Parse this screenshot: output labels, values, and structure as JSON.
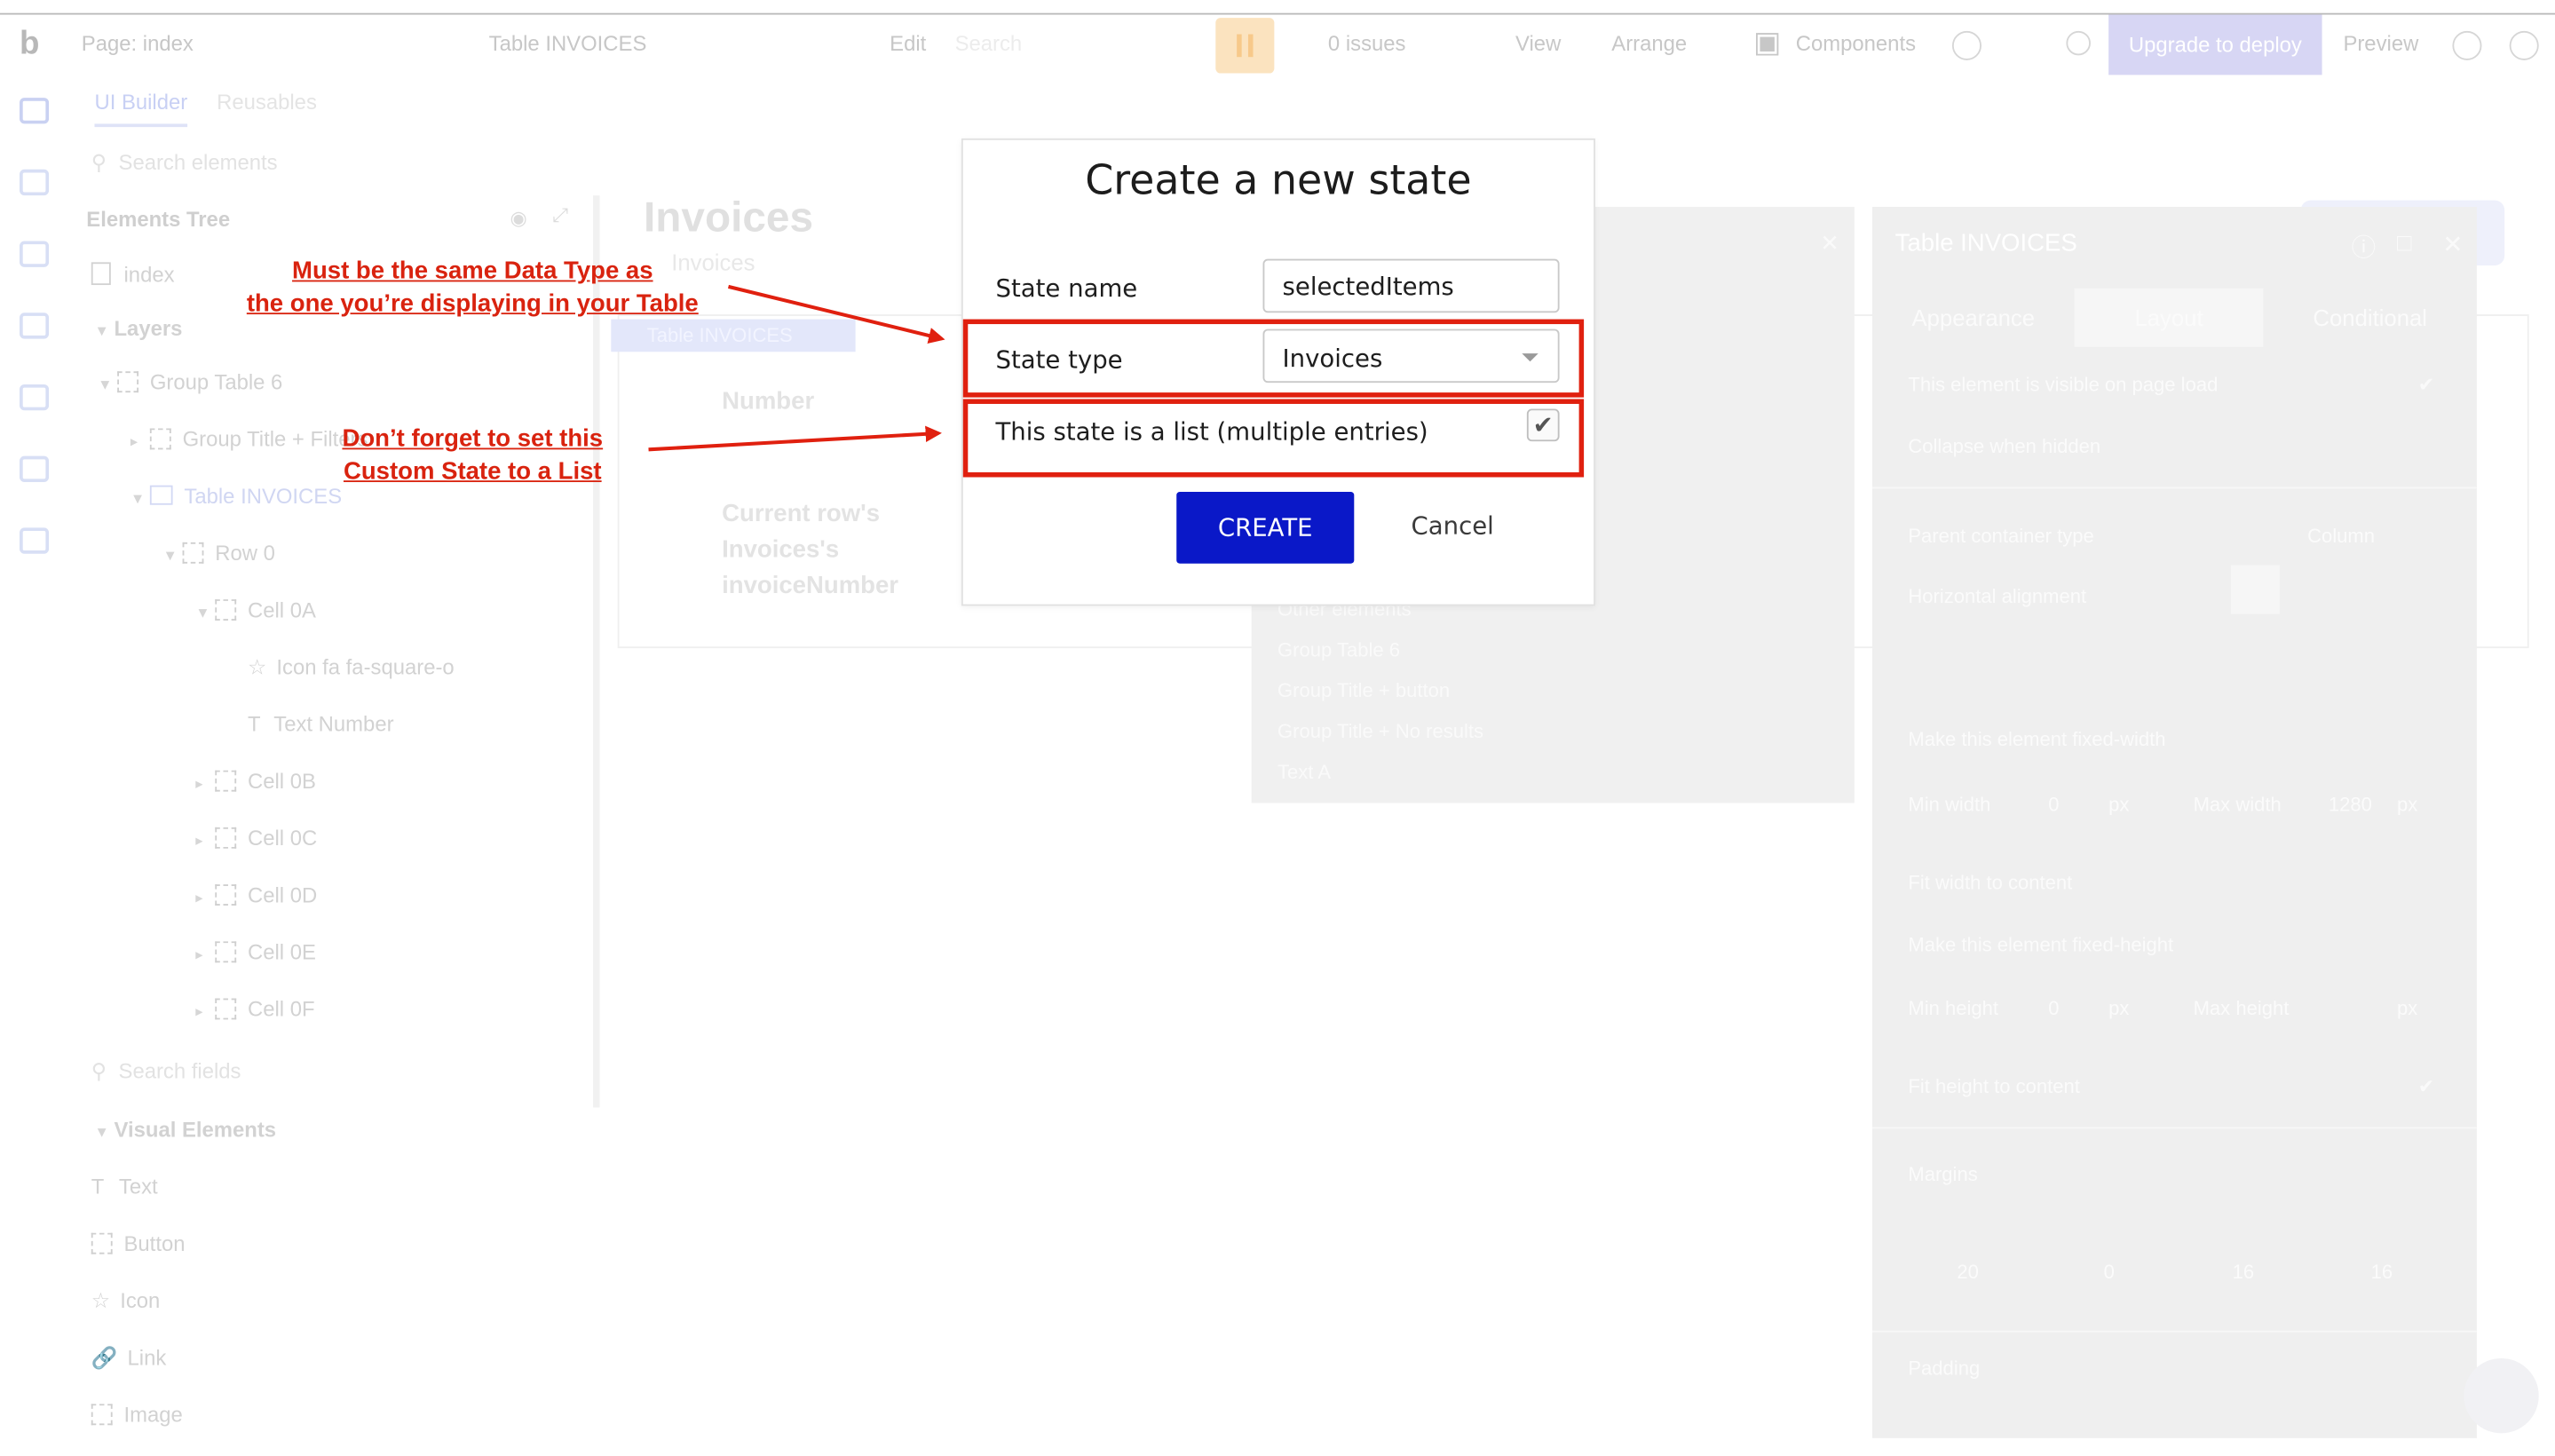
{
  "topbar": {
    "logo": "b",
    "page_label": "Page: index",
    "element_label": "Table INVOICES",
    "edit_label": "Edit",
    "search_label": "Search",
    "issues_label": "0 issues",
    "view_label": "View",
    "arrange_label": "Arrange",
    "components_label": "Components",
    "deploy_label": "Upgrade to deploy",
    "preview_label": "Preview"
  },
  "sidebar": {
    "tab_ui_builder": "UI Builder",
    "tab_other": "Reusables",
    "search_placeholder": "Search elements",
    "tree_title": "Elements Tree",
    "items": [
      {
        "label": "index"
      },
      {
        "label": "Layers"
      },
      {
        "label": "Group Table 6"
      },
      {
        "label": "Group Title + Filters"
      },
      {
        "label": "Table INVOICES"
      },
      {
        "label": "Row 0"
      },
      {
        "label": "Cell 0A"
      },
      {
        "label": "Icon fa fa-square-o"
      },
      {
        "label": "Text Number"
      },
      {
        "label": "Cell 0B"
      },
      {
        "label": "Cell 0C"
      },
      {
        "label": "Cell 0D"
      },
      {
        "label": "Cell 0E"
      },
      {
        "label": "Cell 0F"
      }
    ],
    "search_fields_placeholder": "Search fields",
    "visual_title": "Visual Elements",
    "visual_items": [
      {
        "label": "Text"
      },
      {
        "label": "Button"
      },
      {
        "label": "Icon"
      },
      {
        "label": "Link"
      },
      {
        "label": "Image"
      }
    ]
  },
  "canvas": {
    "title": "Invoices",
    "subtitle": "Invoices",
    "selected_chip": "Table INVOICES",
    "column_header": "Number",
    "cell_line1": "Current row's",
    "cell_line2": "Invoices's",
    "cell_line3": "invoiceNumber"
  },
  "bg_popup": {
    "items": [
      "Other elements",
      "Group Table 6",
      "Group Title + button",
      "Group Title + No results",
      "Text A"
    ]
  },
  "property_editor": {
    "title": "Table INVOICES",
    "tabs": [
      "Appearance",
      "Layout",
      "Conditional"
    ],
    "rows": {
      "visible_on_load": "This element is visible on page load",
      "collapse_hidden": "Collapse when hidden",
      "container_type_label": "Parent container type",
      "container_type_value": "Column",
      "horizontal_alignment": "Horizontal alignment",
      "make_fixed_width": "Make this element fixed-width",
      "min_width_label": "Min width",
      "min_width_value": "0",
      "max_width_label": "Max width",
      "max_width_value": "1280",
      "fit_width": "Fit width to content",
      "make_fixed_height": "Make this element fixed-height",
      "min_height_label": "Min height",
      "min_height_value": "0",
      "max_height_label": "Max height",
      "fit_height": "Fit height to content",
      "margins": "Margins",
      "margin_top": "20",
      "margin_bottom": "0",
      "margin_left": "16",
      "margin_right": "16",
      "padding": "Padding",
      "unit": "px"
    }
  },
  "dialog": {
    "title": "Create a new state",
    "state_name_label": "State name",
    "state_name_value": "selectedItems",
    "state_type_label": "State type",
    "state_type_value": "Invoices",
    "is_list_label": "This state is a list (multiple entries)",
    "is_list_checked": true,
    "create_label": "CREATE",
    "cancel_label": "Cancel"
  },
  "annotations": {
    "note1_line1": "Must be the same Data Type as",
    "note1_line2": "the one you’re displaying in your Table",
    "note2_line1": "Don’t forget to set this",
    "note2_line2": "Custom State to a List",
    "color": "#e0200f"
  },
  "colors": {
    "primary_button": "#0a18c8",
    "annotation_red": "#e0200f"
  }
}
